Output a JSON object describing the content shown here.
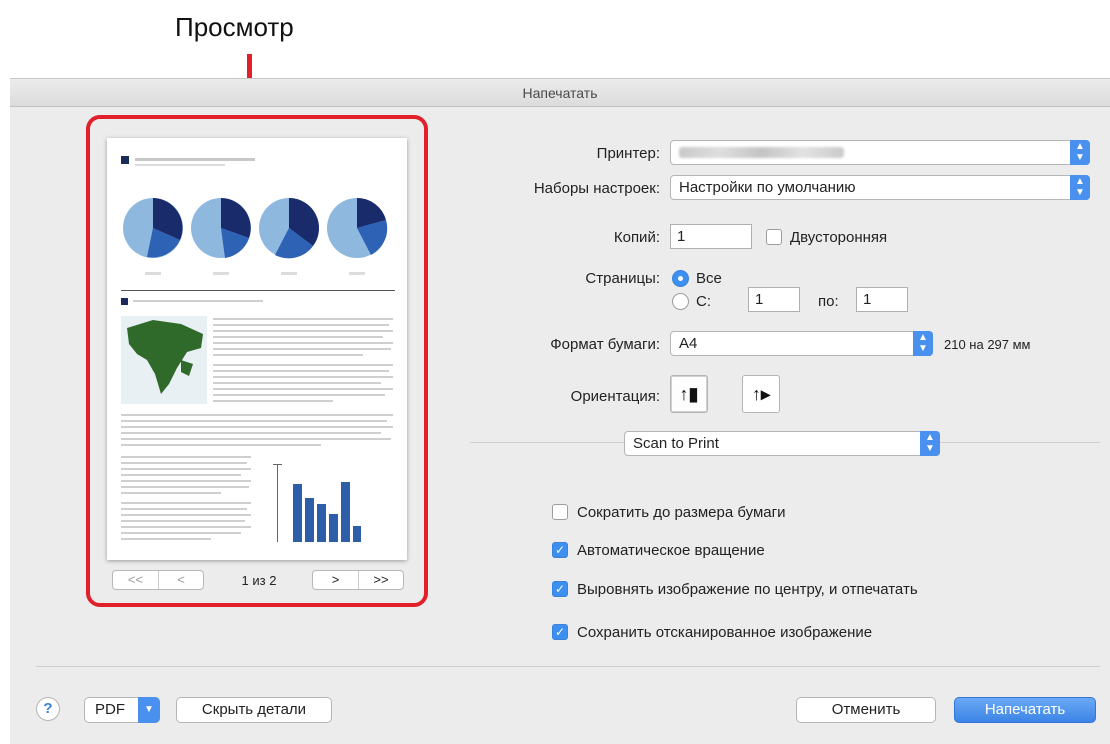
{
  "annotation": {
    "label": "Просмотр"
  },
  "dialog": {
    "title": "Напечатать"
  },
  "preview": {
    "page_indicator": "1 из 2",
    "nav_first": "<<",
    "nav_prev": "<",
    "nav_next": ">",
    "nav_last": ">>"
  },
  "settings": {
    "printer_label": "Принтер:",
    "presets_label": "Наборы настроек:",
    "presets_value": "Настройки по умолчанию",
    "copies_label": "Копий:",
    "copies_value": "1",
    "duplex_label": "Двусторонняя",
    "duplex_checked": false,
    "pages_label": "Страницы:",
    "pages_all_label": "Все",
    "pages_from_label": "С:",
    "pages_from_value": "1",
    "pages_to_label": "по:",
    "pages_to_value": "1",
    "paper_label": "Формат бумаги:",
    "paper_value": "A4",
    "paper_size_text": "210 на 297 мм",
    "orientation_label": "Ориентация:"
  },
  "plugin": {
    "menu_value": "Scan to Print",
    "options": [
      {
        "label": "Сократить до размера бумаги",
        "checked": false
      },
      {
        "label": "Автоматическое вращение",
        "checked": true
      },
      {
        "label": "Выровнять изображение по центру, и отпечатать",
        "checked": true
      },
      {
        "label": "Сохранить отсканированное изображение",
        "checked": true
      }
    ]
  },
  "footer": {
    "help_label": "?",
    "pdf_label": "PDF",
    "hide_details_label": "Скрыть детали",
    "cancel_label": "Отменить",
    "print_label": "Напечатать"
  },
  "colors": {
    "accent": "#3d8ff0",
    "highlight": "#e0202a"
  }
}
